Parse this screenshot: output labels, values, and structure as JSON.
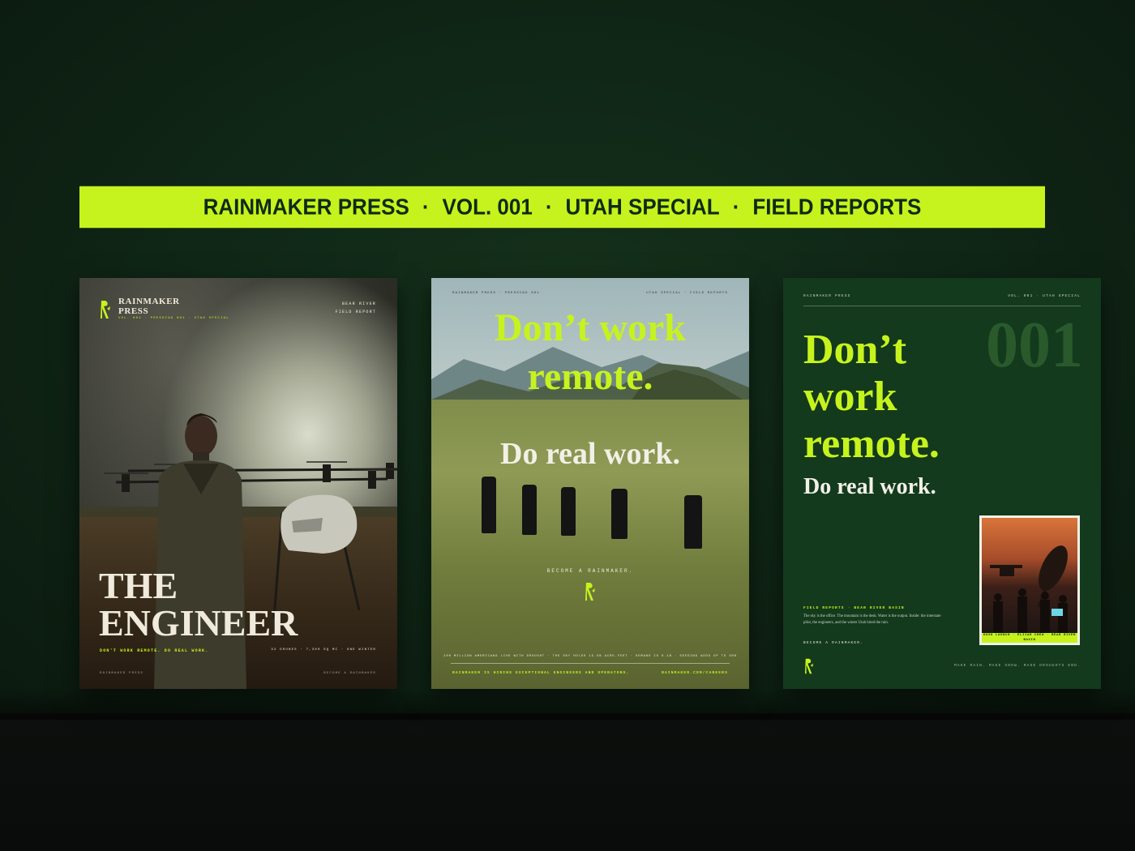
{
  "banner": {
    "items": [
      "RAINMAKER PRESS",
      "VOL. 001",
      "UTAH SPECIAL",
      "FIELD REPORTS"
    ],
    "separator": "·"
  },
  "poster1": {
    "brand_line1": "RAINMAKER",
    "brand_line2": "PRESS",
    "sub_brand": "VOL. 001 · PRESSING 001 · UTAH SPECIAL",
    "location_line1": "BEAR RIVER",
    "location_line2": "FIELD REPORT",
    "title_line1": "THE",
    "title_line2": "ENGINEER",
    "tagline": "DON'T WORK REMOTE. DO REAL WORK.",
    "stats": "32 DRONES · 7,300 SQ MI · ONE WINTER",
    "footer_left": "RAINMAKER PRESS",
    "footer_right": "BECOME A RAINMAKER"
  },
  "poster2": {
    "top_left": "RAINMAKER PRESS · PRESSING 001",
    "top_right": "UTAH SPECIAL · FIELD REPORTS",
    "headline_line1": "Don’t work",
    "headline_line2": "remote.",
    "subhead": "Do real work.",
    "cta": "BECOME A RAINMAKER.",
    "ticker": "100 MILLION AMERICANS LIVE WITH DROUGHT · THE SKY HOLDS 15.5B ACRE-FEET · DEMAND IS 6.1B · SEEDING ADDS UP TO 30%",
    "footer_left": "RAINMAKER IS HIRING EXCEPTIONAL ENGINEERS AND OPERATORS.",
    "footer_right": "RAINMAKER.COM/CAREERS"
  },
  "poster3": {
    "top_left": "RAINMAKER PRESS",
    "top_right": "VOL. 001 · UTAH SPECIAL",
    "big_number": "001",
    "headline_line1": "Don’t",
    "headline_line2": "work",
    "headline_line3": "remote.",
    "subhead": "Do real work.",
    "section_label": "FIELD REPORTS · BEAR RIVER BASIN",
    "body": "The sky is the office. The mountain is the desk. Water is the output. Inside: the interstate pilot, the engineers, and the winter Utah hired the rain.",
    "cta": "BECOME A RAINMAKER.",
    "photo_caption": "DUSK LAUNCH · ELIJAH CREW · BEAR RIVER BASIN",
    "footer_right": "MAKE RAIN. MAKE SNOW. MAKE DROUGHTS END."
  },
  "colors": {
    "accent": "#c6f31d",
    "background": "#102717",
    "poster_green": "#133a1d",
    "cream": "#efeadb"
  },
  "icons": [
    "rainmaker-logo-icon"
  ]
}
